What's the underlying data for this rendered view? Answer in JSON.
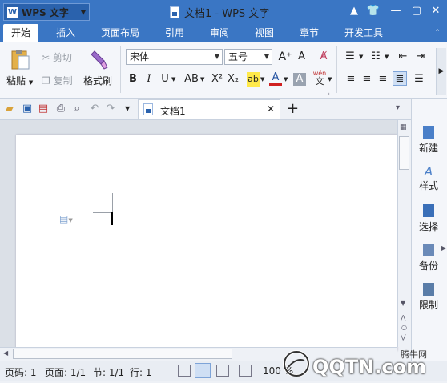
{
  "titlebar": {
    "app_label": "WPS 文字",
    "app_logo": "W",
    "doc_title": "文档1 - WPS 文字",
    "controls": [
      "▲",
      "👕",
      "—",
      "▢",
      "✕"
    ]
  },
  "menu": {
    "tabs": [
      "开始",
      "插入",
      "页面布局",
      "引用",
      "审阅",
      "视图",
      "章节",
      "开发工具"
    ],
    "active": "开始"
  },
  "ribbon": {
    "paste": "粘贴",
    "cut": "剪切",
    "copy": "复制",
    "format_painter": "格式刷",
    "font_name": "宋体",
    "font_size": "五号",
    "grow_font": "A⁺",
    "shrink_font": "A⁻",
    "bold": "B",
    "italic": "I",
    "underline": "U",
    "strike": "AB",
    "superscript": "X²",
    "subscript": "X₂",
    "highlight": "ab",
    "font_color": "A",
    "char_shade": "A",
    "phonetic_top": "wén",
    "phonetic_bottom": "文"
  },
  "quickbar": {
    "doc_tab_label": "文档1",
    "new_tab": "+"
  },
  "sidepanel": {
    "items": [
      "新建",
      "样式",
      "选择",
      "备份",
      "限制"
    ]
  },
  "statusbar": {
    "page_code": "页码: 1",
    "page": "页面: 1/1",
    "section": "节: 1/1",
    "row": "行: 1",
    "zoom": "100 %"
  },
  "watermark": {
    "brand": "QQTN.com",
    "cn": "腾牛网"
  },
  "colors": {
    "title_blue": "#3a76c4",
    "accent_red": "#d04040"
  }
}
